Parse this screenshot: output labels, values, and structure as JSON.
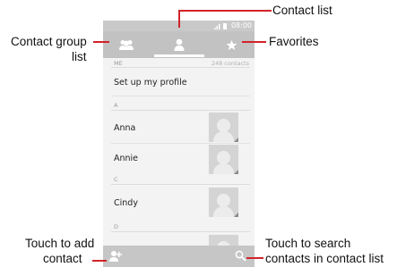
{
  "annotations": {
    "contact_list": "Contact list",
    "contact_group_line1": "Contact group",
    "contact_group_line2": "list",
    "favorites": "Favorites",
    "add_line1": "Touch to add",
    "add_line2": "contact",
    "search_line1": "Touch to search",
    "search_line2": "contacts in contact list",
    "callout_color": "#d2232a"
  },
  "status_bar": {
    "time": "08:00",
    "icons": [
      "signal-icon",
      "battery-icon"
    ]
  },
  "tabs": [
    {
      "name": "contact-group",
      "icon": "group-icon"
    },
    {
      "name": "contact-list",
      "icon": "person-icon",
      "active": true
    },
    {
      "name": "favorites",
      "icon": "star-icon"
    }
  ],
  "list": {
    "me_header": "ME",
    "count": "248 contacts",
    "profile": "Set up my profile",
    "sections": [
      {
        "letter": "A",
        "contacts": [
          "Anna",
          "Annie"
        ]
      },
      {
        "letter": "C",
        "contacts": [
          "Cindy"
        ]
      },
      {
        "letter": "D",
        "contacts": []
      }
    ]
  },
  "bottom_bar": {
    "add_icon": "add-contact-icon",
    "search_icon": "search-icon"
  }
}
